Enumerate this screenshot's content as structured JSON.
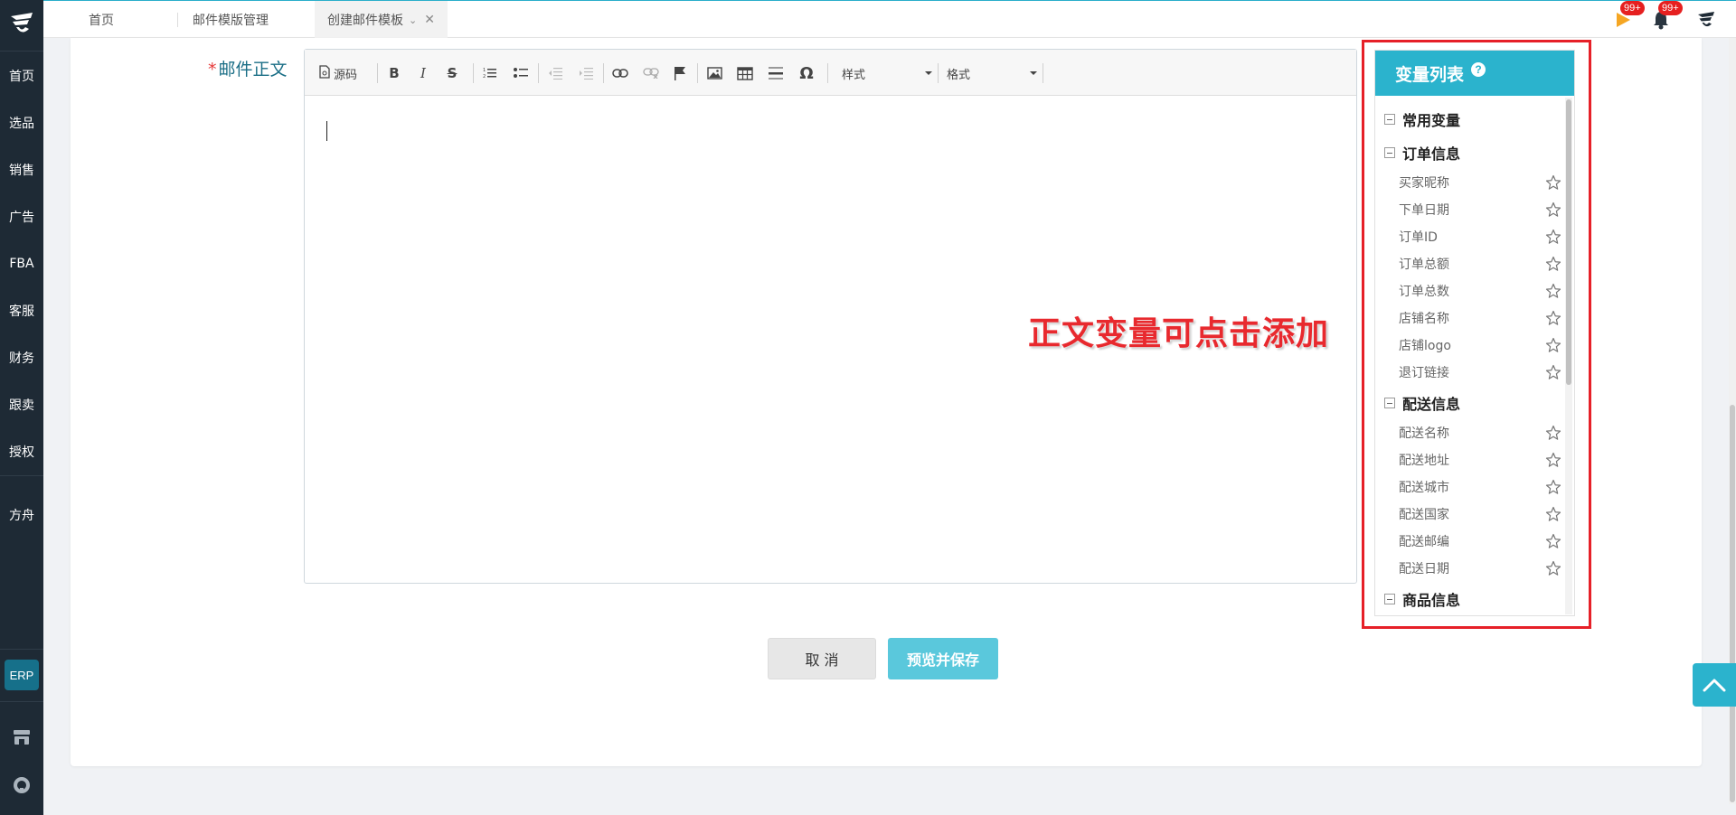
{
  "sidebar": {
    "items": [
      {
        "label": "首页"
      },
      {
        "label": "选品"
      },
      {
        "label": "销售"
      },
      {
        "label": "广告"
      },
      {
        "label": "FBA"
      },
      {
        "label": "客服"
      },
      {
        "label": "财务"
      },
      {
        "label": "跟卖"
      },
      {
        "label": "授权"
      },
      {
        "label": "方舟"
      }
    ],
    "erp_label": "ERP",
    "icons": [
      "store-icon",
      "support-icon"
    ]
  },
  "tabs": [
    {
      "label": "首页"
    },
    {
      "label": "邮件模版管理"
    },
    {
      "label": "创建邮件模板"
    }
  ],
  "notifications": {
    "flag_badge": "99+",
    "bell_badge": "99+"
  },
  "form": {
    "required_mark": "*",
    "body_label": "邮件正文"
  },
  "toolbar": {
    "source_label": "源码",
    "style_label": "样式",
    "format_label": "格式"
  },
  "annotation": "正文变量可点击添加",
  "variables": {
    "title": "变量列表",
    "help": "?",
    "groups": [
      {
        "label": "常用变量",
        "items": []
      },
      {
        "label": "订单信息",
        "items": [
          {
            "label": "买家昵称"
          },
          {
            "label": "下单日期"
          },
          {
            "label": "订单ID"
          },
          {
            "label": "订单总额"
          },
          {
            "label": "订单总数"
          },
          {
            "label": "店铺名称"
          },
          {
            "label": "店铺logo"
          },
          {
            "label": "退订链接"
          }
        ]
      },
      {
        "label": "配送信息",
        "items": [
          {
            "label": "配送名称"
          },
          {
            "label": "配送地址"
          },
          {
            "label": "配送城市"
          },
          {
            "label": "配送国家"
          },
          {
            "label": "配送邮编"
          },
          {
            "label": "配送日期"
          }
        ]
      },
      {
        "label": "商品信息",
        "items": []
      }
    ]
  },
  "buttons": {
    "cancel": "取 消",
    "save": "预览并保存"
  },
  "colors": {
    "accent": "#2bb3cd",
    "sidebar_bg": "#1e2a35",
    "highlight_frame": "#e62028",
    "annotation": "#e8292e"
  }
}
